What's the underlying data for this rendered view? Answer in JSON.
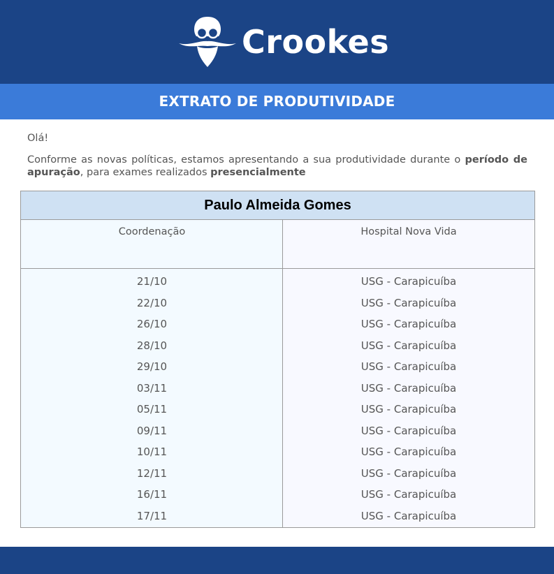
{
  "brand": {
    "name": "Crookes",
    "logo_icon": "bearded-professor-logo-icon"
  },
  "banner": {
    "title": "EXTRATO DE PRODUTIVIDADE"
  },
  "message": {
    "greeting": "Olá!",
    "intro_part1": "Conforme as novas políticas, estamos apresentando a sua produtividade durante o ",
    "intro_bold1": "período de apuração",
    "intro_part2": ", para exames realizados ",
    "intro_bold2": "presencialmente"
  },
  "table": {
    "person_name": "Paulo Almeida Gomes",
    "col_left_header": "Coordenação",
    "col_right_header": "Hospital Nova Vida",
    "rows": [
      {
        "date": "21/10",
        "place": "USG - Carapicuíba"
      },
      {
        "date": "22/10",
        "place": "USG - Carapicuíba"
      },
      {
        "date": "26/10",
        "place": "USG - Carapicuíba"
      },
      {
        "date": "28/10",
        "place": "USG - Carapicuíba"
      },
      {
        "date": "29/10",
        "place": "USG - Carapicuíba"
      },
      {
        "date": "03/11",
        "place": "USG - Carapicuíba"
      },
      {
        "date": "05/11",
        "place": "USG - Carapicuíba"
      },
      {
        "date": "09/11",
        "place": "USG - Carapicuíba"
      },
      {
        "date": "10/11",
        "place": "USG - Carapicuíba"
      },
      {
        "date": "12/11",
        "place": "USG - Carapicuíba"
      },
      {
        "date": "16/11",
        "place": "USG - Carapicuíba"
      },
      {
        "date": "17/11",
        "place": "USG - Carapicuíba"
      }
    ]
  },
  "colors": {
    "header_bg": "#1b4486",
    "banner_bg": "#3b7bd9",
    "name_row_bg": "#cfe1f3"
  }
}
